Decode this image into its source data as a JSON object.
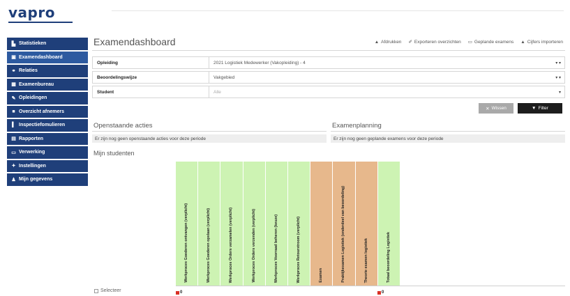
{
  "logo": "vapro",
  "sidebar": {
    "items": [
      {
        "label": "Statistieken",
        "icon": "bar-chart-icon",
        "glyph": "▙"
      },
      {
        "label": "Examendashboard",
        "icon": "dashboard-icon",
        "glyph": "▣"
      },
      {
        "label": "Relaties",
        "icon": "relations-icon",
        "glyph": "⚭"
      },
      {
        "label": "Examenbureau",
        "icon": "building-icon",
        "glyph": "▦"
      },
      {
        "label": "Opleidingen",
        "icon": "education-icon",
        "glyph": "✎"
      },
      {
        "label": "Overzicht afnemers",
        "icon": "car-icon",
        "glyph": "■"
      },
      {
        "label": "Inspectiefomulieren",
        "icon": "file-icon",
        "glyph": "▌"
      },
      {
        "label": "Rapporten",
        "icon": "report-icon",
        "glyph": "▤"
      },
      {
        "label": "Verwerking",
        "icon": "processing-icon",
        "glyph": "▭"
      },
      {
        "label": "Instellingen",
        "icon": "settings-icon",
        "glyph": "✦"
      },
      {
        "label": "Mijn gegevens",
        "icon": "user-icon",
        "glyph": "♟"
      }
    ]
  },
  "header": {
    "title": "Examendashboard",
    "actions": [
      {
        "label": "Afdrukken",
        "icon": "print-icon",
        "glyph": "▲"
      },
      {
        "label": "Exporteren overzichten",
        "icon": "pencil-icon",
        "glyph": "✐"
      },
      {
        "label": "Geplande examens",
        "icon": "calendar-icon",
        "glyph": "▭"
      },
      {
        "label": "Cijfers importeren",
        "icon": "user-plus-icon",
        "glyph": "▲"
      }
    ]
  },
  "filters": {
    "opleiding_label": "Opleiding",
    "opleiding_value": "2021 Logistiek Medewerker (Vakopleiding) - 4",
    "werkperiode_label": "Beoordelingswijze",
    "werkperiode_value": "Vakgebied",
    "student_label": "Student",
    "student_placeholder": "Alle"
  },
  "buttons": {
    "clear": "Wissen",
    "filter": "Filter"
  },
  "panels": {
    "left_title": "Openstaande acties",
    "left_body": "Er zijn nog geen openstaande acties voor deze periode",
    "right_title": "Examenplanning",
    "right_body": "Er zijn nog geen geplande examens voor deze periode"
  },
  "students_title": "Mijn studenten",
  "columns": [
    {
      "label": "Werkproces Goederen ontvangen (verplicht)",
      "status": "green",
      "color": "#cdf3b3"
    },
    {
      "label": "Werkproces Goederen opslaan (verplicht)",
      "status": "green",
      "color": "#cdf3b3"
    },
    {
      "label": "Werkproces Orders verzamelen (verplicht)",
      "status": "green",
      "color": "#cdf3b3"
    },
    {
      "label": "Werkproces Orders verzenden (verplicht)",
      "status": "green",
      "color": "#cdf3b3"
    },
    {
      "label": "Werkproces Voorraad beheren (keuze)",
      "status": "green",
      "color": "#cdf3b3"
    },
    {
      "label": "Werkproces Retourstroom (verplicht)",
      "status": "green",
      "color": "#cdf3b3"
    },
    {
      "label": "Examen",
      "status": "orange",
      "color": "#e7b88c"
    },
    {
      "label": "Praktijkexamen Logistiek (onderdeel van beoordeling)",
      "status": "orange",
      "color": "#e7b88c"
    },
    {
      "label": "Theorie examen logistiek",
      "status": "orange",
      "color": "#e7b88c"
    },
    {
      "label": "Totaal beoordeling Logistiek",
      "status": "green",
      "color": "#cdf3b3"
    }
  ],
  "legend": {
    "label": "Selecteer"
  },
  "marks": [
    {
      "label": "0"
    },
    {
      "label": "0"
    }
  ]
}
